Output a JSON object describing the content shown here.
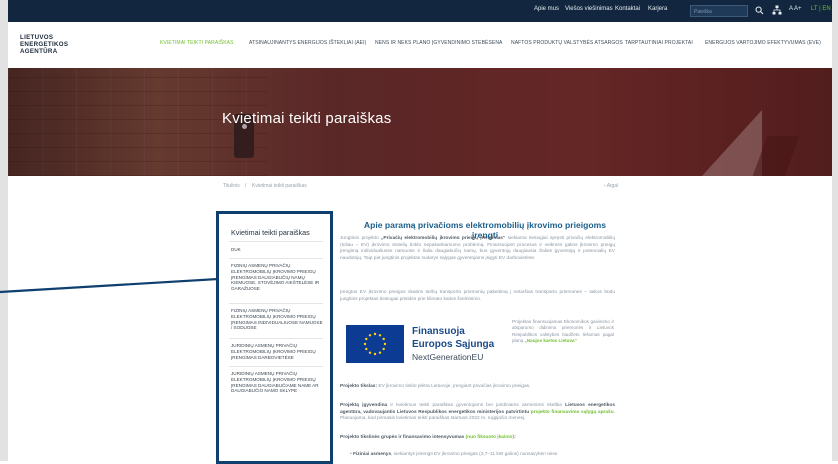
{
  "topbar": {
    "links": [
      "Apie mus",
      "Viešos viešinimas",
      "Kontaktai",
      "Karjera"
    ],
    "search_placeholder": "Paieška",
    "lang_font": "A A+",
    "lang": "LT | EN"
  },
  "logo": {
    "line1": "LIETUVOS",
    "line2": "ENERGETIKOS",
    "line3": "AGENTŪRA"
  },
  "nav": [
    "KVIETIMAI TEIKTI PARAIŠKAS",
    "ATSINAUJINANTYS ENERGIJOS IŠTEKLIAI (AEI)",
    "NENS IR NEKS PLANO ĮGYVENDINIMO STEBĖSENA",
    "NAFTOS PRODUKTŲ VALSTYBĖS ATSARGOS",
    "TARPTAUTINIAI PROJEKTAI",
    "ENERGIJOS VARTOJIMO EFEKTYVUMAS (EVE)"
  ],
  "hero": {
    "title": "Kvietimai teikti paraiškas"
  },
  "breadcrumb": {
    "home": "Titulinis",
    "sep": "/",
    "current": "Kvietimai teikti paraiškas",
    "back": "‹ Atgal"
  },
  "sidebar": {
    "title": "Kvietimai teikti paraiškas",
    "items": [
      "DUK",
      "FIZINIŲ ASMENŲ PRIVAČIŲ ELEKTROMOBILIŲ ĮKROVIMO PRIEIGŲ ĮRENGIMAS DAUGIABUČIŲ NAMŲ KIEMUOSE, STOVĖJIMO AIKŠTELĖSE IR GARAŽUOSE",
      "FIZINIŲ ASMENŲ PRIVAČIŲ ELEKTROMOBILIŲ ĮKROVIMO PRIEIGŲ ĮRENGIMAS INDIVIDUALIUOSE NAMUOSE / SODUOSE",
      "JURIDINIŲ ASMENŲ PRIVAČIŲ ELEKTROMOBILIŲ ĮKROVIMO PRIEIGŲ ĮRENGIMAS DARBOVIETĖSE",
      "JURIDINIŲ ASMENŲ PRIVAČIŲ ELEKTROMOBILIŲ ĮKROVIMO PRIEIGŲ ĮRENGIMAS DAUGIABUČIAME NAME AR DAUGIABUČIO NAMO SKLYPE"
    ]
  },
  "main": {
    "title": "Apie paramą privačioms elektromobilių įkrovimo prieigoms įrengti",
    "p1_start": "Jungtinio projekto ",
    "p1_bold": "„Privačių elektromobilių įkrovimo prieigų įrengimas“",
    "p1_rest": " siekiama tiesiogiai spręsti privačių elektromobilių (toliau – EV) įkrovimo stotelių tinklo nepakankamumo problemą. Finansuojant procesus ir veikmes galios įkrovimo prieigų įrengimą individualiuose namuose ir šalia daugiabučių namų, bus gyventojų daugiausia Šalies gyventojų ir potencialių EV naudotojų. Taip pat jungtinis projektas sudarys sąlygas gyventojams įsigyti EV darbovietėse.",
    "p2": "Įrengtos EV įkrovimo prieigos skatins taršių transporto priemonių pakeitimą į netaršias transporto priemones – taikos būdu jungtinis projektas tiesiogiai prisidės prie klimato kaitos švelninimo.",
    "eu_line1": "Finansuoja",
    "eu_line2": "Europos Sąjunga",
    "eu_line3": "NextGenerationEU",
    "eu_desc_start": "Projektas finansuojamas Ekonomikos gaivinimo ir atsparumo didinimo priemonės ir Lietuvos Respublikos valstybės biudžeto lėšomas pagal planą ",
    "eu_desc_green": "„Naujos kartos Lietuva“",
    "goal_label": "Projekto tikslas:",
    "goal_text": " EV įkrovimo tinklo plėtra Lietuvoje, įrengiant privačias įkrovimo prieigas.",
    "impl_label": "Projektą įgyvendina",
    "impl_text": " ir kvietimus teikti paraiškas gyventojams bei juridiniams asmenims skelbia ",
    "impl_bold": "Lietuvos energetikos agentūra, vadovaujantis Lietuvos Respublikos energetikos ministerijos patvirtintu",
    "impl_green": " projekto finansavimo sąlygų aprašu",
    "impl_end": ". Planuojama, kad pirmasis kvietimas teikti paraiškas startuos 2022 m. rugpjūčio mėnesį.",
    "groups_label": "Projekto tikslinės grupės ir finansavimo intensyvumas",
    "groups_green": " (nuo fiksuoto įkainio)",
    "groups_end": ":",
    "bullet_bold": "Fiziniai asmenys",
    "bullet_text": ", siekiantys įsirengti EV įkrovimo prieigas (3,7–11 kW galios) nuosavybėn teise"
  },
  "colors": {
    "accent_green": "#6fbf2f",
    "navy": "#12273f",
    "sidebar_border": "#0e3f6e",
    "title_blue": "#1b5f8c"
  }
}
